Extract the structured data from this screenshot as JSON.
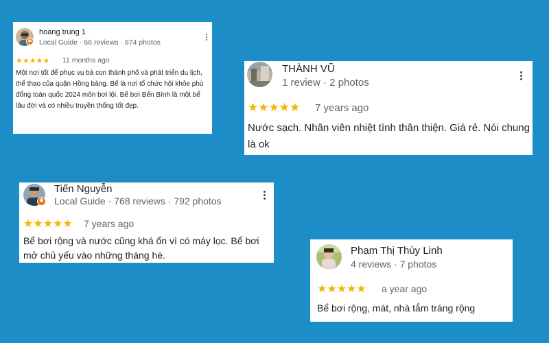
{
  "background_color": "#1c8dc7",
  "star_color": "#f4b400",
  "reviews": [
    {
      "name": "hoang trung 1",
      "meta": "Local Guide · 66 reviews · 874 photos",
      "stars": "★★★★★",
      "time_ago": "11 months ago",
      "text": "Một nơi tốt để phục vụ bà con thành phố và phát triển du lịch, thể thao của quận Hồng bàng.   Bể là nơi tổ chức hội khỏe phù đổng toàn quốc 2024 môn bơi lội. Bể bơi Bến Bính là một bể lâu đời và có nhiều truyền thống tốt đẹp."
    },
    {
      "name": "THÀNH VŨ",
      "meta": "1 review · 2 photos",
      "stars": "★★★★★",
      "time_ago": "7 years ago",
      "text": "Nước sạch. Nhân viên nhiệt tình thân thiện. Giá rẻ. Nói chung là ok"
    },
    {
      "name": "Tiến Nguyễn",
      "meta": "Local Guide · 768 reviews · 792 photos",
      "stars": "★★★★★",
      "time_ago": "7 years ago",
      "text": "Bể bơi rộng và nước cũng khá ổn vì có máy lọc. Bể bơi mở chủ yếu vào những tháng hè."
    },
    {
      "name": "Phạm Thị Thùy Linh",
      "meta": "4 reviews · 7 photos",
      "stars": "★★★★★",
      "time_ago": "a year ago",
      "text": "Bể bơi rộng, mát, nhà tắm tráng rộng"
    }
  ],
  "icons": {
    "more": "more-vert-icon",
    "local_guide_badge": "local-guide-badge-icon",
    "avatar": "avatar"
  }
}
